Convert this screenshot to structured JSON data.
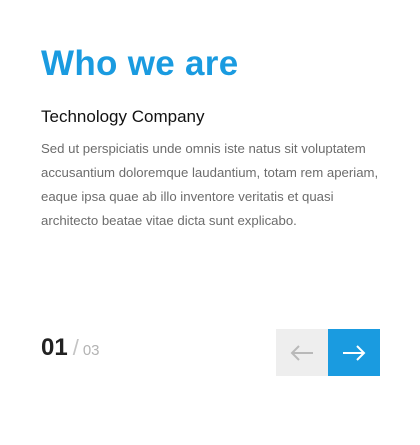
{
  "section": {
    "title": "Who we are",
    "subtitle": "Technology Company",
    "body": "Sed ut perspiciatis unde omnis iste natus sit voluptatem accusantium doloremque laudantium, totam rem aperiam, eaque ipsa quae ab illo inventore veritatis et quasi architecto beatae vitae dicta sunt explicabo."
  },
  "pager": {
    "current": "01",
    "separator": "/",
    "total": "03"
  },
  "nav": {
    "prev_icon": "arrow-left-icon",
    "next_icon": "arrow-right-icon"
  },
  "colors": {
    "accent": "#1a9be0",
    "prev_bg": "#eeeeee",
    "title": "#1a9be0",
    "body_text": "#6c6c6c"
  }
}
